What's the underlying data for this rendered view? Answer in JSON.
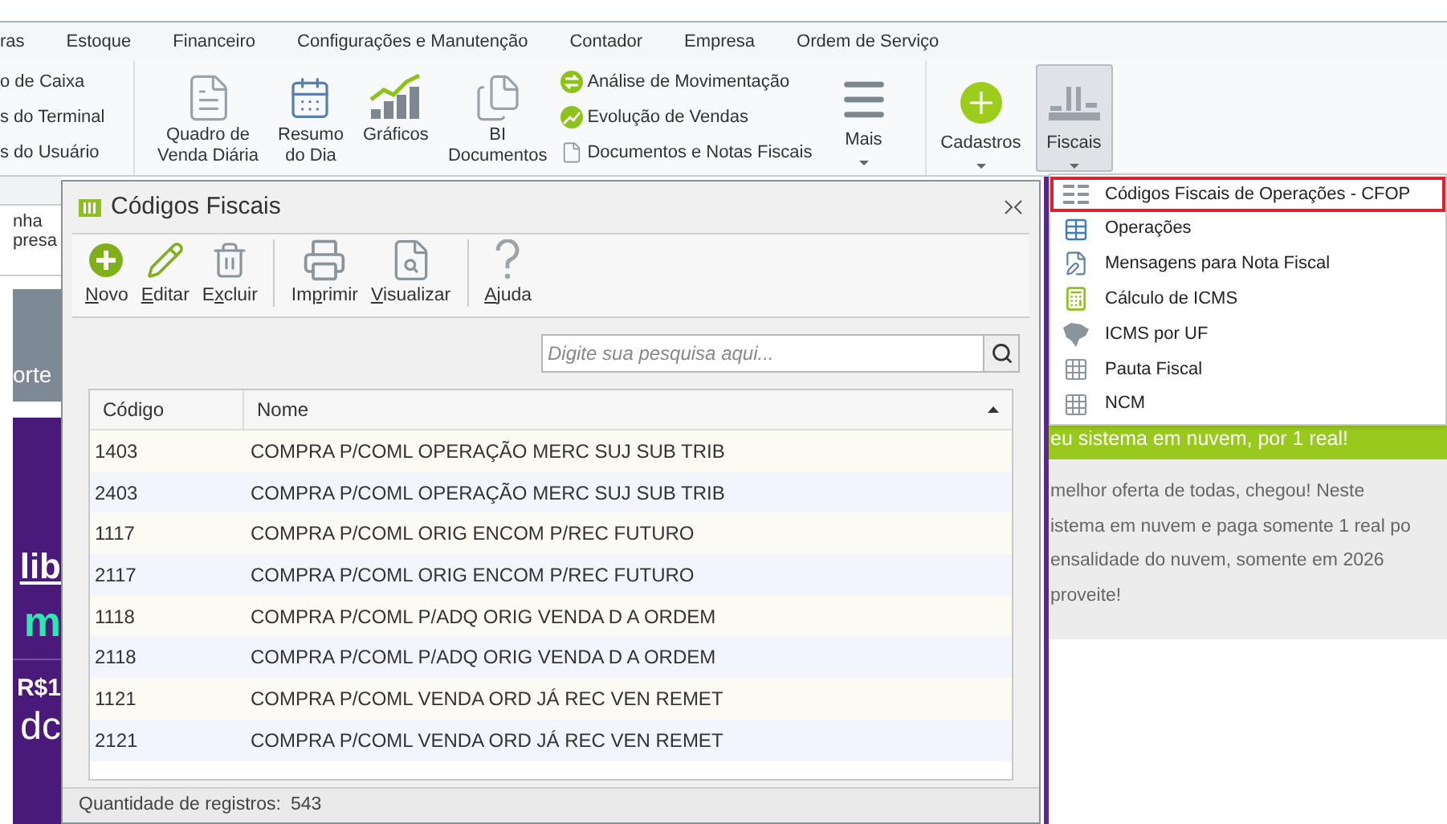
{
  "menu_bar": [
    {
      "label": "ras"
    },
    {
      "label": "Estoque"
    },
    {
      "label": "Financeiro"
    },
    {
      "label": "Configurações e Manutenção"
    },
    {
      "label": "Contador"
    },
    {
      "label": "Empresa"
    },
    {
      "label": "Ordem de Serviço"
    }
  ],
  "ribbon": {
    "cut_items": [
      "o de Caixa",
      "s do Terminal",
      "s do Usuário"
    ],
    "large_buttons": [
      {
        "kind": "sheet",
        "lines": [
          "Quadro de",
          "Venda Diária"
        ]
      },
      {
        "kind": "calendar",
        "lines": [
          "Resumo",
          "do Dia"
        ]
      },
      {
        "kind": "chart",
        "lines": [
          "Gráficos"
        ]
      },
      {
        "kind": "documents",
        "lines": [
          "BI",
          "Documentos"
        ]
      }
    ],
    "list_items": [
      {
        "kind": "exchange",
        "label": "Análise de Movimentação"
      },
      {
        "kind": "growth",
        "label": "Evolução de Vendas"
      },
      {
        "kind": "page",
        "label": "Documentos e Notas Fiscais"
      }
    ],
    "menu_buttons": [
      {
        "kind": "more",
        "label": "Mais",
        "selected": false
      },
      {
        "kind": "add",
        "label": "Cadastros",
        "selected": false
      },
      {
        "kind": "fiscal",
        "label": "Fiscais",
        "selected": true
      }
    ]
  },
  "background": {
    "left_texts": [
      "nha",
      "presa"
    ],
    "left_block_text": "orte",
    "promo": {
      "link": "lib",
      "accent": "m",
      "price": "R$1",
      "word": "dc"
    },
    "banner": "eu sistema em nuvem, por 1 real!",
    "paragraph": [
      "melhor oferta de todas, chegou! Neste",
      "istema em nuvem e paga somente 1 real po",
      "ensalidade do nuvem, somente em 2026",
      "proveite!"
    ]
  },
  "dialog": {
    "title": "Códigos Fiscais",
    "toolbar": [
      {
        "kind": "new",
        "label": {
          "key": "N",
          "after": "ovo"
        },
        "separator_before": false
      },
      {
        "kind": "edit",
        "label": {
          "key": "E",
          "after": "ditar"
        },
        "separator_before": false
      },
      {
        "kind": "delete",
        "label": {
          "before": "E",
          "key": "x",
          "after": "cluir"
        },
        "separator_before": false
      },
      {
        "kind": "print",
        "label": {
          "before": "Im",
          "key": "p",
          "after": "rimir"
        },
        "separator_before": true
      },
      {
        "kind": "preview",
        "label": {
          "key": "V",
          "after": "isualizar"
        },
        "separator_before": false
      },
      {
        "kind": "help",
        "label": {
          "key": "A",
          "after": "juda"
        },
        "separator_before": true
      }
    ],
    "search": {
      "placeholder": "Digite sua pesquisa aqui..."
    },
    "table": {
      "columns": [
        {
          "label": "Código",
          "sorted": false
        },
        {
          "label": "Nome",
          "sorted": true
        }
      ],
      "rows": [
        [
          "1403",
          "COMPRA P/COML OPERAÇÃO MERC SUJ SUB TRIB"
        ],
        [
          "2403",
          "COMPRA P/COML OPERAÇÃO MERC SUJ SUB TRIB"
        ],
        [
          "1117",
          "COMPRA P/COML ORIG ENCOM P/REC FUTURO"
        ],
        [
          "2117",
          "COMPRA P/COML ORIG ENCOM P/REC FUTURO"
        ],
        [
          "1118",
          "COMPRA P/COML P/ADQ ORIG VENDA D A ORDEM"
        ],
        [
          "2118",
          "COMPRA P/COML P/ADQ ORIG VENDA D A ORDEM"
        ],
        [
          "1121",
          "COMPRA P/COML VENDA ORD JÁ REC VEN REMET"
        ],
        [
          "2121",
          "COMPRA P/COML VENDA ORD JÁ REC VEN REMET"
        ]
      ]
    },
    "status_bar": {
      "label": "Quantidade de registros:",
      "value": "543"
    }
  },
  "dropdown": [
    {
      "kind": "codes",
      "label": "Códigos Fiscais de Operações - CFOP",
      "selected": true
    },
    {
      "kind": "table",
      "label": "Operações",
      "selected": false
    },
    {
      "kind": "message",
      "label": "Mensagens para Nota Fiscal",
      "selected": false
    },
    {
      "kind": "calculator",
      "label": "Cálculo de ICMS",
      "selected": false
    },
    {
      "kind": "map",
      "label": "ICMS por UF",
      "selected": false
    },
    {
      "kind": "grid",
      "label": "Pauta Fiscal",
      "selected": false
    },
    {
      "kind": "grid",
      "label": "NCM",
      "selected": false
    }
  ]
}
